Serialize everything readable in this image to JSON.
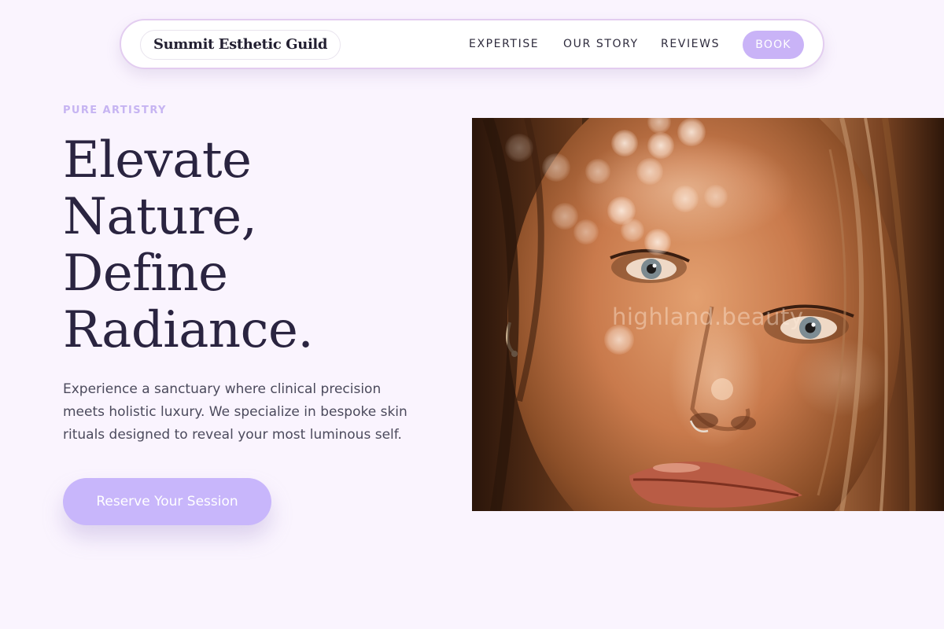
{
  "brand": {
    "name": "Summit Esthetic Guild"
  },
  "nav": {
    "links": [
      "EXPERTISE",
      "OUR STORY",
      "REVIEWS"
    ],
    "book_label": "BOOK"
  },
  "hero": {
    "eyebrow": "PURE ARTISTRY",
    "headline_lines": [
      "Elevate",
      "Nature,",
      "Define",
      "Radiance."
    ],
    "description": "Experience a sanctuary where clinical precision meets holistic luxury. We specialize in bespoke skin rituals designed to reveal your most luminous self.",
    "cta_label": "Reserve Your Session"
  },
  "photo": {
    "subject": "close-up portrait of a freckled woman with bokeh light",
    "watermark": "highland.beauty"
  },
  "colors": {
    "background": "#faf4fe",
    "accent": "#c8b6fb",
    "eyebrow": "#c6b4f2",
    "heading": "#2a2440",
    "body_text": "#4b4a5c"
  }
}
